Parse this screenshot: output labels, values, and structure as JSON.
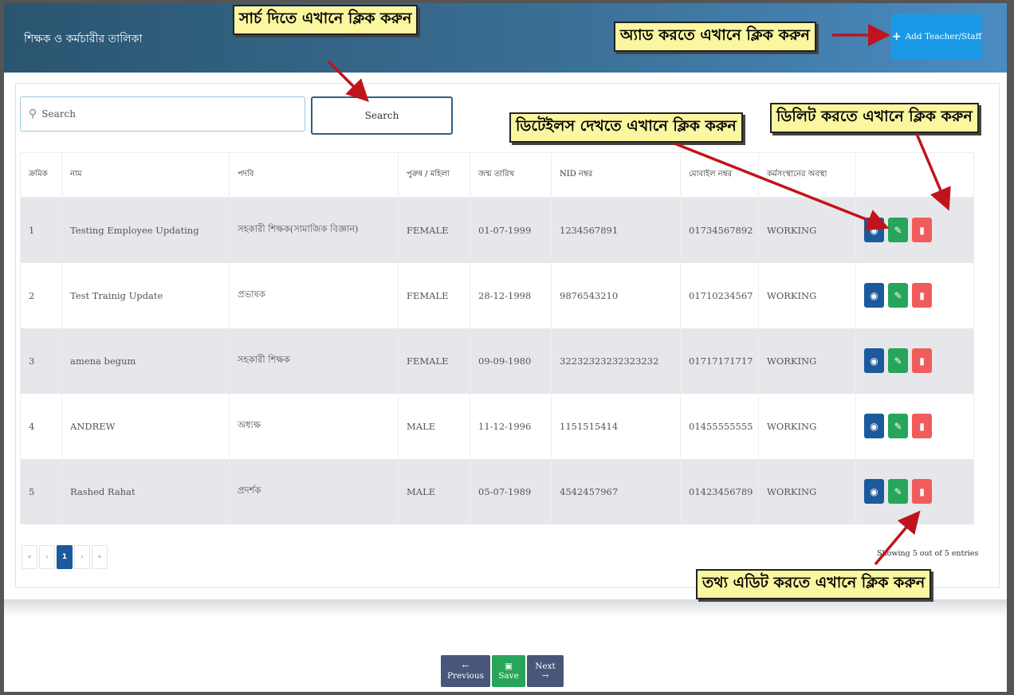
{
  "header": {
    "title": "শিক্ষক ও কর্মচারীর তালিকা",
    "add_label": "Add Teacher/Staff"
  },
  "search": {
    "placeholder": "Search",
    "button_label": "Search"
  },
  "table": {
    "columns": [
      "ক্রমিক",
      "নাম",
      "পদবি",
      "পুরুষ / মহিলা",
      "জন্ম তারিখ",
      "NID নম্বর",
      "মোবাইল নম্বর",
      "কর্মসংস্থানের অবস্থা",
      ""
    ],
    "rows": [
      [
        "1",
        "Testing Employee Updating",
        "সহকারী শিক্ষক(সামাজিক বিজ্ঞান)",
        "FEMALE",
        "01-07-1999",
        "1234567891",
        "01734567892",
        "WORKING"
      ],
      [
        "2",
        "Test Trainig Update",
        "প্রভাষক",
        "FEMALE",
        "28-12-1998",
        "9876543210",
        "01710234567",
        "WORKING"
      ],
      [
        "3",
        "amena begum",
        "সহকারী শিক্ষক",
        "FEMALE",
        "09-09-1980",
        "32232323232323232",
        "01717171717",
        "WORKING"
      ],
      [
        "4",
        "ANDREW",
        "অধ্যক্ষ",
        "MALE",
        "11-12-1996",
        "1151515414",
        "01455555555",
        "WORKING"
      ],
      [
        "5",
        "Rashed Rahat",
        "প্রদর্শক",
        "MALE",
        "05-07-1989",
        "4542457967",
        "01423456789",
        "WORKING"
      ]
    ]
  },
  "pagination": {
    "first": "«",
    "prev": "‹",
    "current": "1",
    "next": "›",
    "last": "»",
    "showing": "Showing 5 out of 5 entries"
  },
  "footer": {
    "previous": "Previous",
    "save": "Save",
    "next": "Next"
  },
  "callouts": {
    "search": "সার্চ দিতে এখানে ক্লিক করুন",
    "add": "অ্যাড করতে এখানে ক্লিক করুন",
    "details": "ডিটেইলস দেখতে এখানে ক্লিক করুন",
    "delete": "ডিলিট করতে এখানে ক্লিক করুন",
    "edit": "তথ্য এডিট করতে এখানে ক্লিক করুন"
  },
  "colors": {
    "header_start": "#2a5570",
    "header_end": "#4a8cc2",
    "add_button": "#1a9ae6",
    "view": "#1b5a9c",
    "edit": "#27a55a",
    "delete": "#f05c5c",
    "callout": "#fbf6a0",
    "arrow": "#c0141c"
  },
  "icons": {
    "search": "search-icon",
    "add": "plus-icon",
    "view": "eye-icon",
    "edit": "edit-icon",
    "delete": "trash-icon",
    "save": "floppy-icon"
  }
}
